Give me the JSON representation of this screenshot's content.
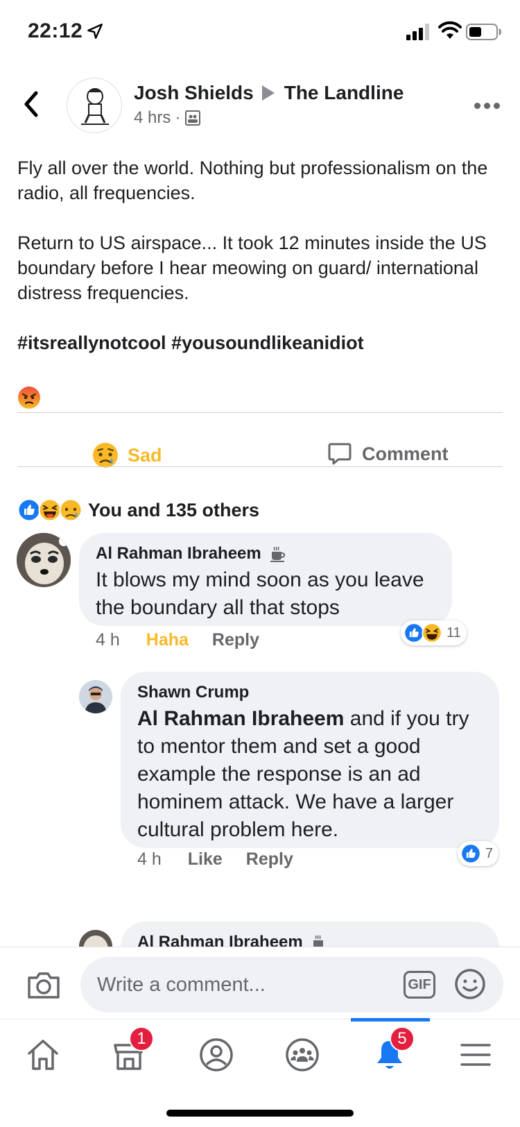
{
  "status_bar": {
    "time": "22:12"
  },
  "post": {
    "author": "Josh Shields",
    "group": "The Landline",
    "time": "4 hrs",
    "separator": "·",
    "paragraph1": "Fly all over the world. Nothing but professionalism on the radio, all frequencies.",
    "paragraph2": "Return to US airspace... It took 12 minutes inside the US boundary before I hear meowing on guard/ international distress frequencies.",
    "hashtags": "#itsreallynotcool #yousoundlikeanidiot",
    "actions": {
      "reaction_label": "Sad",
      "comment_label": "Comment"
    },
    "reactions_summary": "You and 135 others"
  },
  "comments": [
    {
      "name": "Al Rahman Ibraheem",
      "text": "It blows my mind soon as you leave the boundary all that stops",
      "time": "4 h",
      "reaction_label": "Haha",
      "reply_label": "Reply",
      "reaction_count": "11"
    },
    {
      "name": "Shawn Crump",
      "mention": "Al Rahman Ibraheem",
      "text": " and if you try to mentor them and set a good example the response is an ad hominem attack. We have a larger cultural problem here.",
      "time": "4 h",
      "like_label": "Like",
      "reply_label": "Reply",
      "reaction_count": "7"
    },
    {
      "name": "Al Rahman Ibraheem"
    }
  ],
  "composer": {
    "placeholder": "Write a comment...",
    "gif_label": "GIF"
  },
  "tabbar": {
    "marketplace_badge": "1",
    "notifications_badge": "5"
  },
  "colors": {
    "accent": "#1877f2",
    "sad": "#f7b928",
    "badge": "#e41e3f",
    "bubble": "#eff1f4"
  }
}
